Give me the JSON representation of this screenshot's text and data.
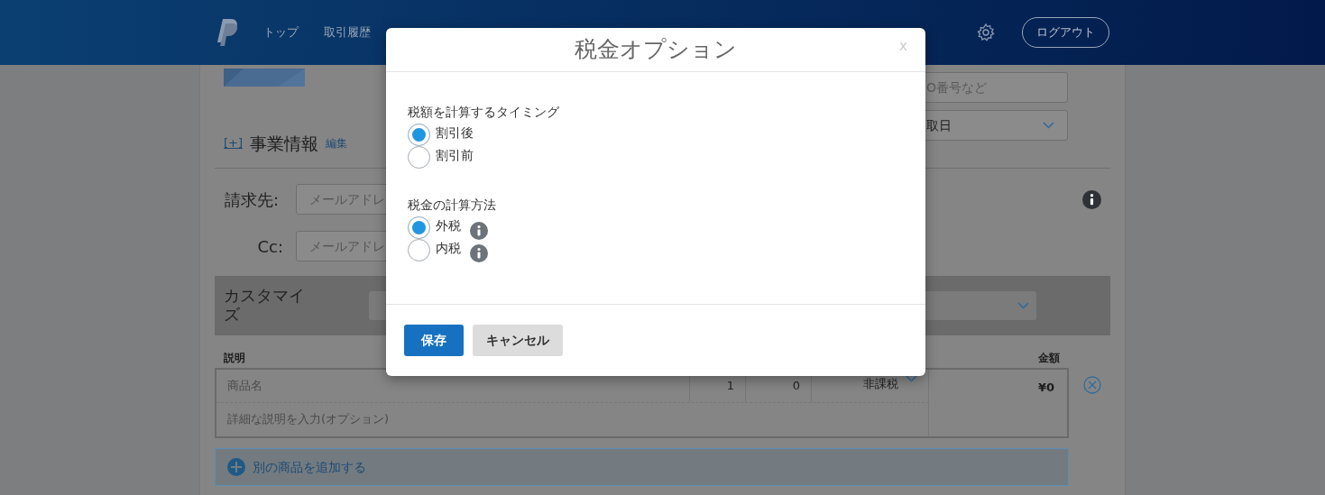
{
  "header": {
    "nav": [
      {
        "label": "トップ"
      },
      {
        "label": "取引履歴"
      }
    ],
    "logout": "ログアウト"
  },
  "page": {
    "business_info": {
      "toggle": "[+]",
      "title": "事業情報",
      "edit": "編集"
    },
    "reference_field": {
      "placeholder": "O番号など"
    },
    "due_select": {
      "value": "取日"
    },
    "bill_to": {
      "label": "請求先:",
      "placeholder": "メールアドレ"
    },
    "cc": {
      "label": "Cc:",
      "placeholder": "メールアドレ"
    },
    "customize": {
      "label": "カスタマイズ"
    },
    "items_table": {
      "columns": [
        "説明",
        "金額"
      ],
      "rows": [
        {
          "name_placeholder": "商品名",
          "quantity": "1",
          "price": "0",
          "tax": "非課税",
          "amount": "¥0",
          "description_placeholder": "詳細な説明を入力(オプション)"
        }
      ]
    },
    "add_item": "別の商品を追加する"
  },
  "modal": {
    "title": "税金オプション",
    "close": "x",
    "groups": [
      {
        "label": "税額を計算するタイミング",
        "options": [
          {
            "label": "割引後",
            "selected": true,
            "info": false
          },
          {
            "label": "割引前",
            "selected": false,
            "info": false
          }
        ]
      },
      {
        "label": "税金の計算方法",
        "options": [
          {
            "label": "外税",
            "selected": true,
            "info": true
          },
          {
            "label": "内税",
            "selected": false,
            "info": true
          }
        ]
      }
    ],
    "buttons": [
      {
        "label": "保存",
        "kind": "primary"
      },
      {
        "label": "キャンセル",
        "kind": "secondary"
      }
    ]
  }
}
